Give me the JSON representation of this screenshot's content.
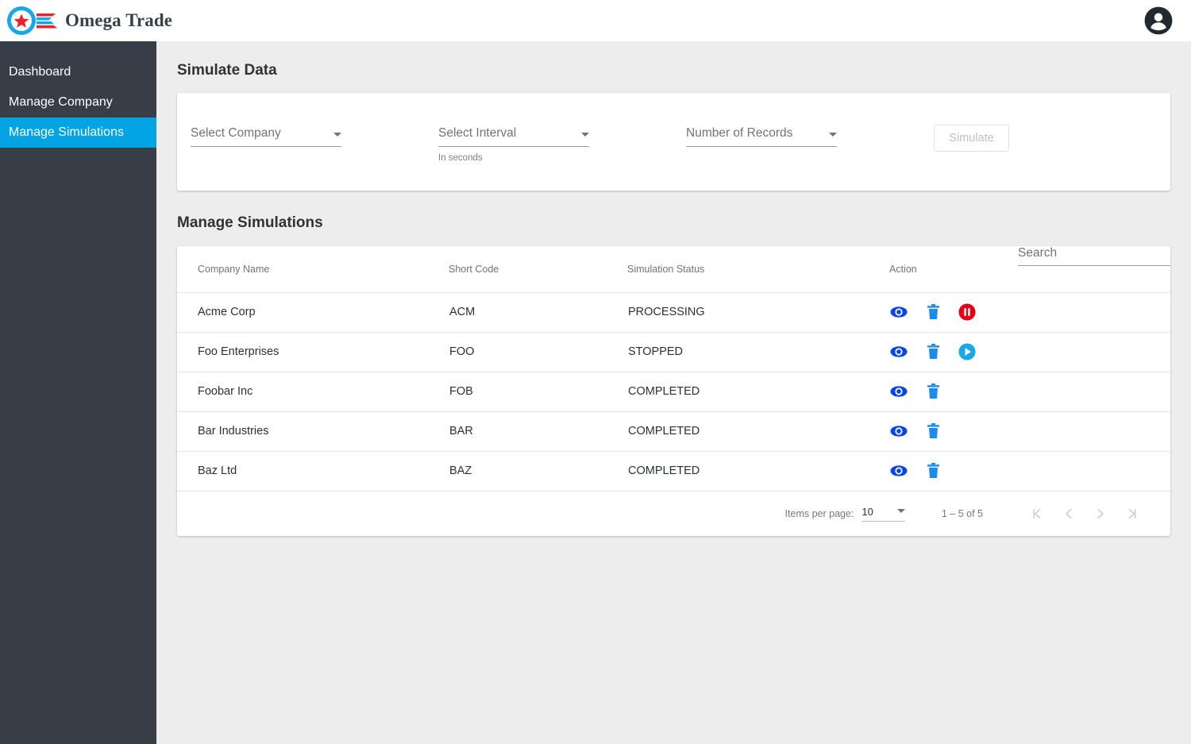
{
  "app": {
    "brand_name": "Omega Trade",
    "logo_icon": "circle-star-flag-logo",
    "avatar_icon": "account-circle-icon"
  },
  "sidebar": {
    "items": [
      {
        "label": "Dashboard",
        "active": false
      },
      {
        "label": "Manage Company",
        "active": false
      },
      {
        "label": "Manage Simulations",
        "active": true
      }
    ]
  },
  "simulate_section": {
    "title": "Simulate Data",
    "fields": [
      {
        "label": "Select Company",
        "hint": "",
        "icon": "chevron-down-icon"
      },
      {
        "label": "Select Interval",
        "hint": "In seconds",
        "icon": "chevron-down-icon"
      },
      {
        "label": "Number of Records",
        "hint": "",
        "icon": "chevron-down-icon"
      }
    ],
    "simulate_button": "Simulate"
  },
  "manage_section": {
    "title": "Manage Simulations",
    "search_placeholder": "Search",
    "columns": [
      "Company Name",
      "Short Code",
      "Simulation Status",
      "Action"
    ],
    "rows": [
      {
        "company": "Acme Corp",
        "code": "ACM",
        "status": "PROCESSING",
        "actions": [
          "view",
          "delete",
          "pause"
        ]
      },
      {
        "company": "Foo Enterprises",
        "code": "FOO",
        "status": "STOPPED",
        "actions": [
          "view",
          "delete",
          "play"
        ]
      },
      {
        "company": "Foobar Inc",
        "code": "FOB",
        "status": "COMPLETED",
        "actions": [
          "view",
          "delete"
        ]
      },
      {
        "company": "Bar Industries",
        "code": "BAR",
        "status": "COMPLETED",
        "actions": [
          "view",
          "delete"
        ]
      },
      {
        "company": "Baz Ltd",
        "code": "BAZ",
        "status": "COMPLETED",
        "actions": [
          "view",
          "delete"
        ]
      }
    ],
    "paginator": {
      "items_per_page_label": "Items per page:",
      "items_per_page_value": "10",
      "range_label": "1 – 5 of 5",
      "first_icon": "first-page-icon",
      "prev_icon": "previous-page-icon",
      "next_icon": "next-page-icon",
      "last_icon": "last-page-icon"
    }
  },
  "colors": {
    "accent": "#03a4e4",
    "sidebar": "#373e47",
    "background": "#ededed",
    "view_icon": "#0b46e0",
    "delete_icon": "#1a8cf0",
    "pause_icon": "#e60012",
    "play_icon": "#18a8e8"
  }
}
